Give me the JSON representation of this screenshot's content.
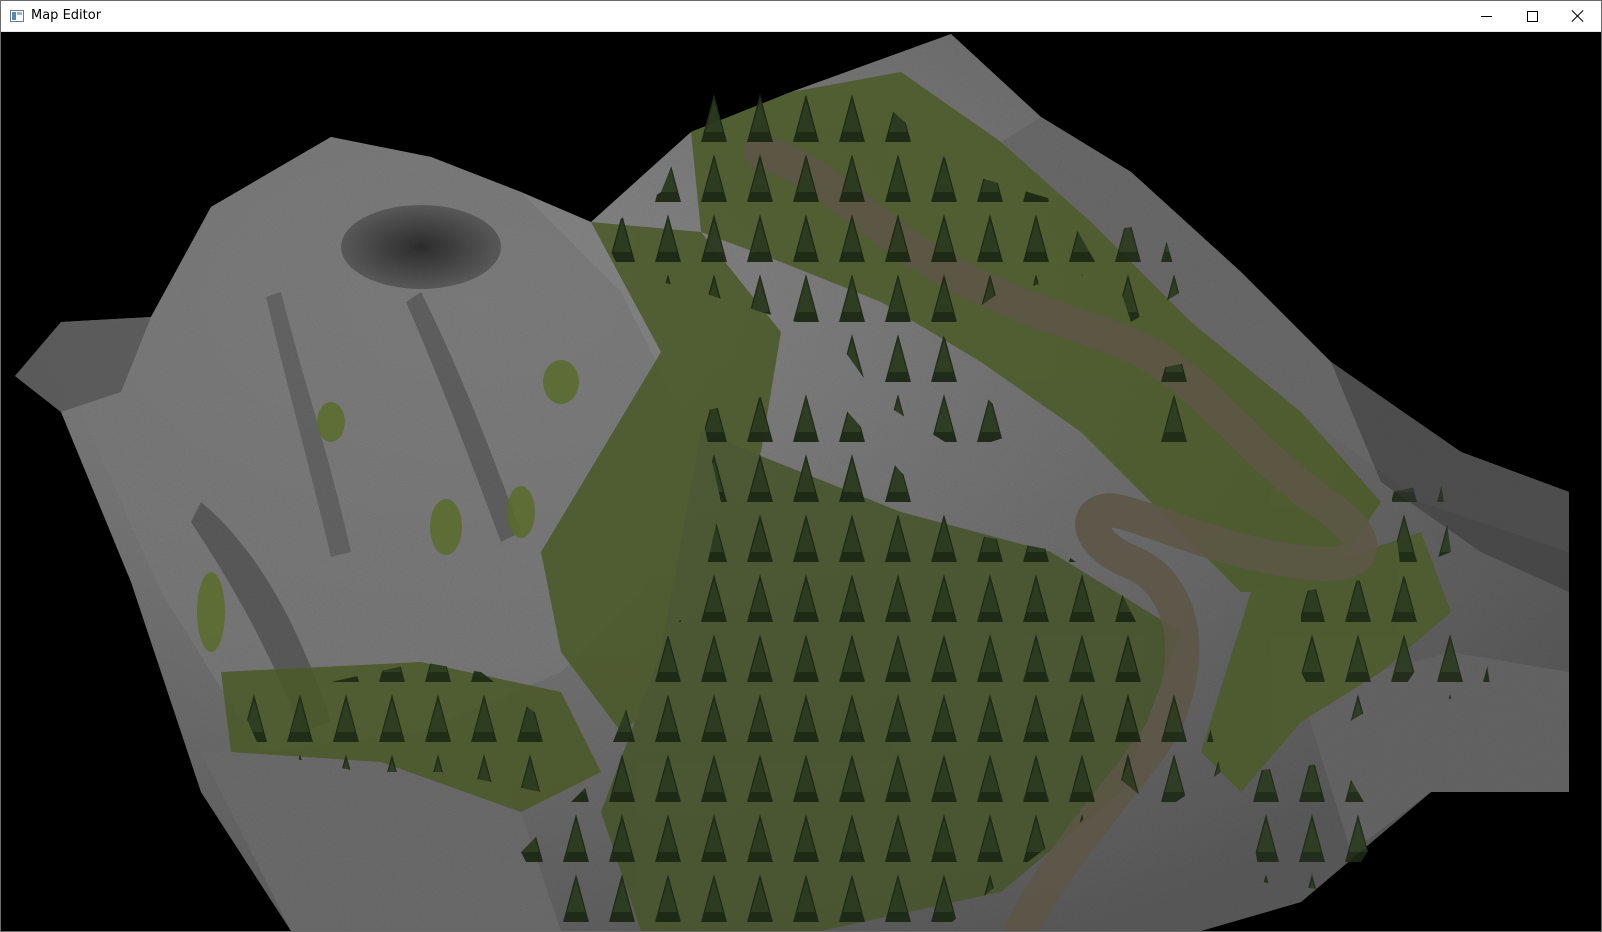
{
  "window": {
    "title": "Map Editor",
    "icon": "app-window-icon"
  },
  "controls": {
    "minimize_icon": "minimize-icon",
    "maximize_icon": "maximize-icon",
    "close_icon": "close-icon"
  },
  "viewport": {
    "scene": "3d-terrain",
    "colors": {
      "background": "#000000",
      "rock": "#7c7c7c",
      "rock_dark": "#4a4a4a",
      "grass": "#4f5e2a",
      "forest": "#22301a",
      "path": "#5a5546"
    }
  }
}
